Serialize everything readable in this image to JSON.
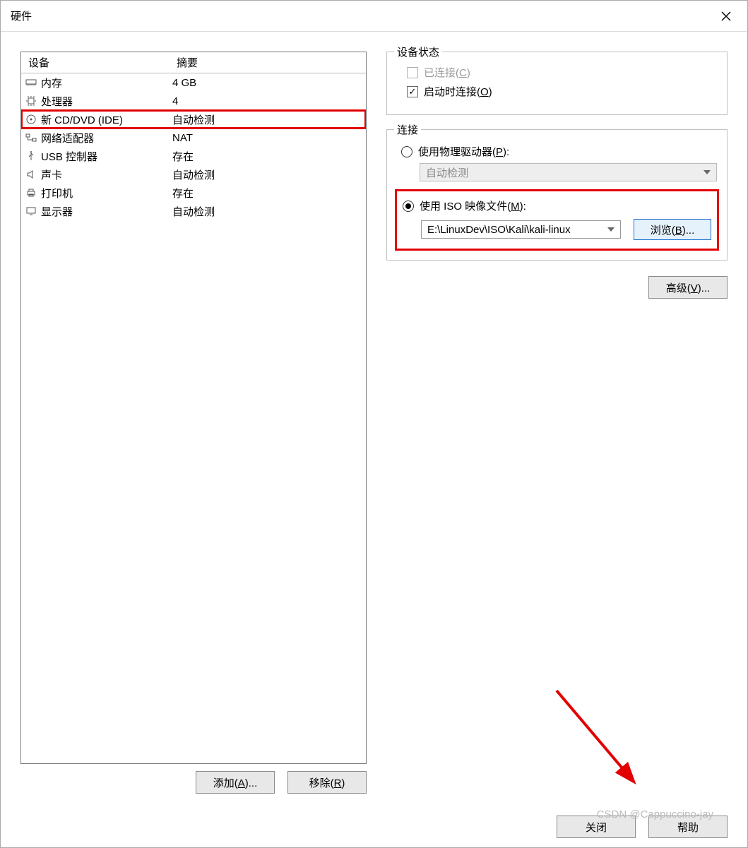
{
  "title": "硬件",
  "devices": {
    "header_device": "设备",
    "header_summary": "摘要",
    "rows": [
      {
        "name": "内存",
        "summary": "4 GB",
        "icon": "memory"
      },
      {
        "name": "处理器",
        "summary": "4",
        "icon": "cpu"
      },
      {
        "name": "新 CD/DVD (IDE)",
        "summary": "自动检测",
        "icon": "disc",
        "selected": true
      },
      {
        "name": "网络适配器",
        "summary": "NAT",
        "icon": "network"
      },
      {
        "name": "USB 控制器",
        "summary": "存在",
        "icon": "usb"
      },
      {
        "name": "声卡",
        "summary": "自动检测",
        "icon": "sound"
      },
      {
        "name": "打印机",
        "summary": "存在",
        "icon": "printer"
      },
      {
        "name": "显示器",
        "summary": "自动检测",
        "icon": "display"
      }
    ]
  },
  "buttons": {
    "add": "添加(A)...",
    "remove": "移除(R)",
    "close": "关闭",
    "help": "帮助",
    "advanced": "高级(V)...",
    "browse": "浏览(B)..."
  },
  "status_group": {
    "legend": "设备状态",
    "connected_label": "已连接(C)",
    "connected_checked": false,
    "connected_enabled": false,
    "connect_poweron_label": "启动时连接(O)",
    "connect_poweron_checked": true
  },
  "connection_group": {
    "legend": "连接",
    "physical_label": "使用物理驱动器(P):",
    "physical_selected": false,
    "physical_value": "自动检测",
    "iso_label": "使用 ISO 映像文件(M):",
    "iso_selected": true,
    "iso_path": "E:\\LinuxDev\\ISO\\Kali\\kali-linux"
  },
  "watermark": "CSDN @Cappuccino-jay"
}
